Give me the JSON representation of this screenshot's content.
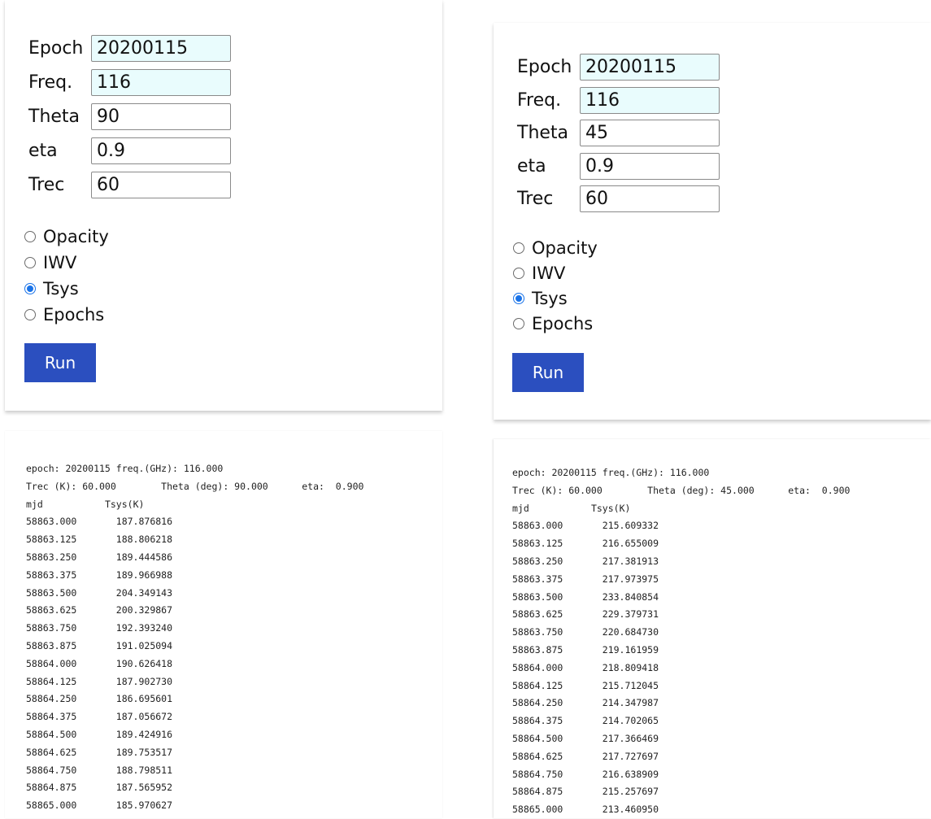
{
  "left": {
    "form": {
      "epoch_label": "Epoch",
      "epoch_value": "20200115",
      "freq_label": "Freq.",
      "freq_value": "116",
      "theta_label": "Theta",
      "theta_value": "90",
      "eta_label": "eta",
      "eta_value": "0.9",
      "trec_label": "Trec",
      "trec_value": "60"
    },
    "options": [
      "Opacity",
      "IWV",
      "Tsys",
      "Epochs"
    ],
    "selected_option": "Tsys",
    "run_label": "Run",
    "output": {
      "header_line1": "epoch: 20200115 freq.(GHz): 116.000",
      "header_line2": "Trec (K): 60.000        Theta (deg): 90.000      eta:  0.900",
      "col_mjd": "mjd",
      "col_tsys": "Tsys(K)",
      "rows": [
        [
          "58863.000",
          "187.876816"
        ],
        [
          "58863.125",
          "188.806218"
        ],
        [
          "58863.250",
          "189.444586"
        ],
        [
          "58863.375",
          "189.966988"
        ],
        [
          "58863.500",
          "204.349143"
        ],
        [
          "58863.625",
          "200.329867"
        ],
        [
          "58863.750",
          "192.393240"
        ],
        [
          "58863.875",
          "191.025094"
        ],
        [
          "58864.000",
          "190.626418"
        ],
        [
          "58864.125",
          "187.902730"
        ],
        [
          "58864.250",
          "186.695601"
        ],
        [
          "58864.375",
          "187.056672"
        ],
        [
          "58864.500",
          "189.424916"
        ],
        [
          "58864.625",
          "189.753517"
        ],
        [
          "58864.750",
          "188.798511"
        ],
        [
          "58864.875",
          "187.565952"
        ],
        [
          "58865.000",
          "185.970627"
        ]
      ]
    }
  },
  "right": {
    "form": {
      "epoch_label": "Epoch",
      "epoch_value": "20200115",
      "freq_label": "Freq.",
      "freq_value": "116",
      "theta_label": "Theta",
      "theta_value": "45",
      "eta_label": "eta",
      "eta_value": "0.9",
      "trec_label": "Trec",
      "trec_value": "60"
    },
    "options": [
      "Opacity",
      "IWV",
      "Tsys",
      "Epochs"
    ],
    "selected_option": "Tsys",
    "run_label": "Run",
    "output": {
      "header_line1": "epoch: 20200115 freq.(GHz): 116.000",
      "header_line2": "Trec (K): 60.000        Theta (deg): 45.000      eta:  0.900",
      "col_mjd": "mjd",
      "col_tsys": "Tsys(K)",
      "rows": [
        [
          "58863.000",
          "215.609332"
        ],
        [
          "58863.125",
          "216.655009"
        ],
        [
          "58863.250",
          "217.381913"
        ],
        [
          "58863.375",
          "217.973975"
        ],
        [
          "58863.500",
          "233.840854"
        ],
        [
          "58863.625",
          "229.379731"
        ],
        [
          "58863.750",
          "220.684730"
        ],
        [
          "58863.875",
          "219.161959"
        ],
        [
          "58864.000",
          "218.809418"
        ],
        [
          "58864.125",
          "215.712045"
        ],
        [
          "58864.250",
          "214.347987"
        ],
        [
          "58864.375",
          "214.702065"
        ],
        [
          "58864.500",
          "217.366469"
        ],
        [
          "58864.625",
          "217.727697"
        ],
        [
          "58864.750",
          "216.638909"
        ],
        [
          "58864.875",
          "215.257697"
        ],
        [
          "58865.000",
          "213.460950"
        ]
      ]
    }
  }
}
